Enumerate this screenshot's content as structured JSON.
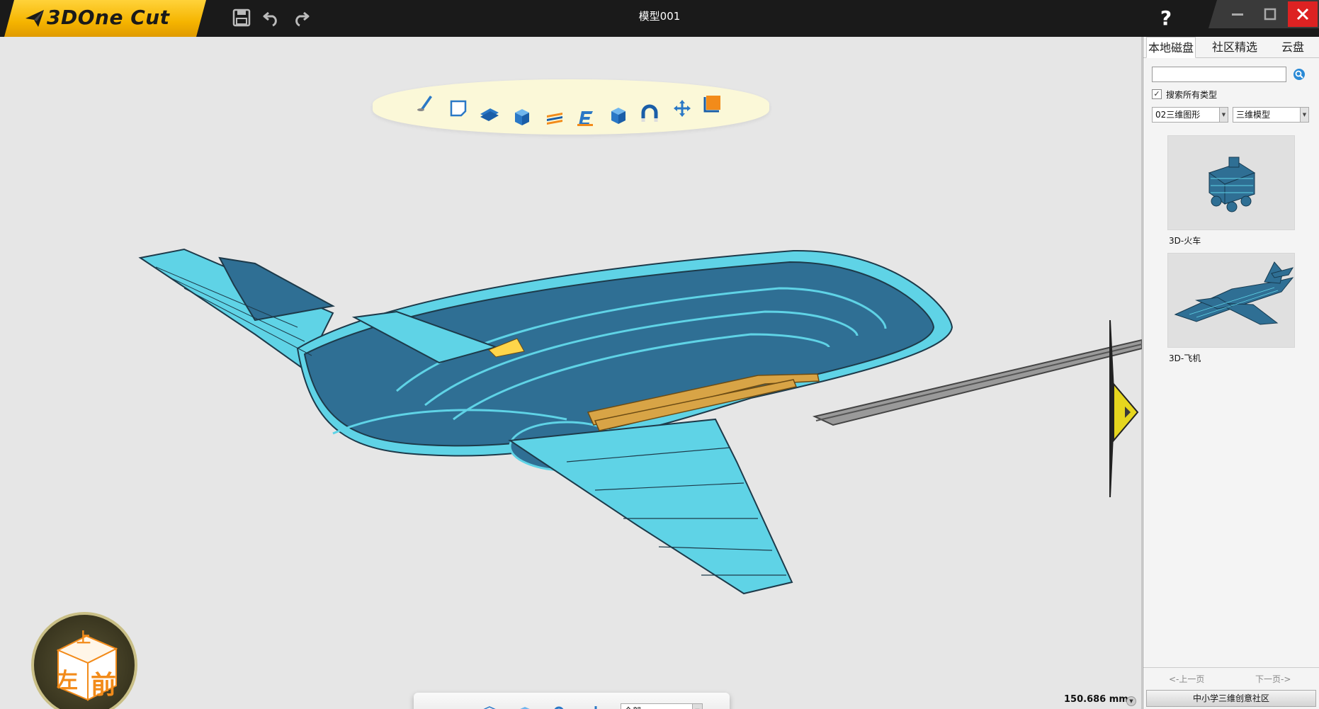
{
  "app": {
    "logo_text": "3DOne Cut",
    "document_title": "模型001",
    "help_label": "?"
  },
  "colors": {
    "titlebar": "#1a1a1a",
    "logo_yellow": "#f5b400",
    "model_blue": "#2f6f94",
    "model_cyan": "#5fd3e6",
    "model_wood": "#d8a446",
    "close_red": "#dd2222"
  },
  "toolbar": {
    "icons": [
      "sketch-icon",
      "sheet-icon",
      "extrude-layer-icon",
      "solid-box-icon",
      "slice-stack-icon",
      "text-edit-icon",
      "cube-icon",
      "magnet-icon",
      "move-arrows-icon",
      "material-color-icon"
    ]
  },
  "view_cube": {
    "top": "上",
    "front": "前",
    "left": "左"
  },
  "bottom_bar": {
    "filter_value": "全部",
    "icons": [
      "visibility-eye-icon",
      "wireframe-cube-icon",
      "shaded-box-icon",
      "zoom-icon",
      "export-icon"
    ]
  },
  "measure": {
    "value": "150.686 mm"
  },
  "panel": {
    "tabs": [
      "本地磁盘",
      "社区精选",
      "云盘"
    ],
    "active_tab": "本地磁盘",
    "search_placeholder": "",
    "search_all_types_label": "搜索所有类型",
    "search_all_types_checked": true,
    "category_select": "02三维图形",
    "type_select": "三维模型",
    "models": [
      {
        "label": "3D-火车",
        "icon": "train-model-icon"
      },
      {
        "label": "3D-飞机",
        "icon": "airplane-model-icon"
      }
    ],
    "prev_page": "<-上一页",
    "next_page": "下一页->",
    "community_button": "中小学三维创意社区"
  }
}
